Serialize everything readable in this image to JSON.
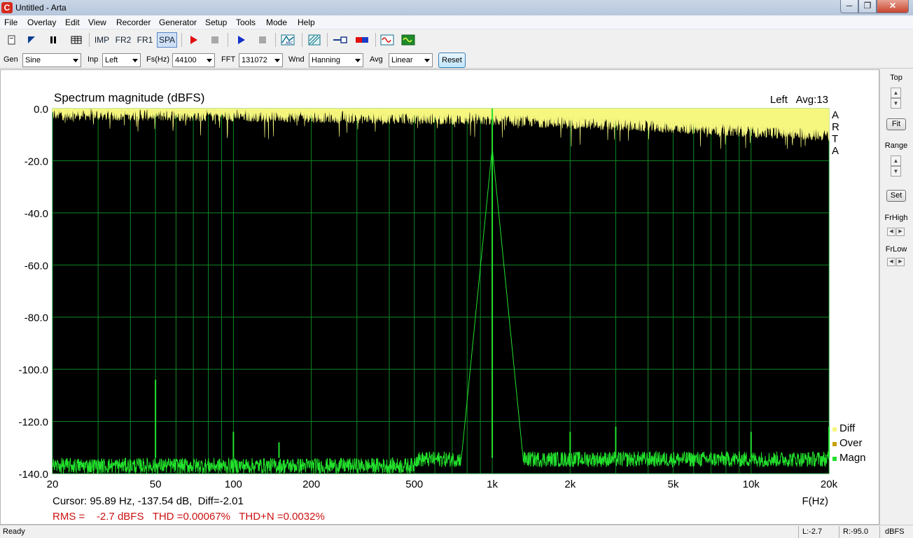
{
  "window": {
    "title": "Untitled - Arta",
    "app_icon_letter": "C",
    "controls": [
      "minimize-icon",
      "restore-icon",
      "close-icon"
    ]
  },
  "menu": [
    "File",
    "Overlay",
    "Edit",
    "View",
    "Recorder",
    "Generator",
    "Setup",
    "Tools",
    "Mode",
    "Help"
  ],
  "toolbar": {
    "mode_buttons": [
      "IMP",
      "FR2",
      "FR1",
      "SPA"
    ],
    "active_mode": "SPA",
    "icons": [
      "new-file-icon",
      "open-marker-icon",
      "pause-icon",
      "grid-view-icon",
      "record-icon",
      "stop-icon",
      "play-icon",
      "stop-icon",
      "abc-icon",
      "hatch-icon",
      "probe-icon",
      "meter-icon",
      "generator-wave-icon",
      "scope-icon"
    ]
  },
  "controls": {
    "gen_label": "Gen",
    "gen_value": "Sine",
    "inp_label": "Inp",
    "inp_value": "Left",
    "fs_label": "Fs(Hz)",
    "fs_value": "44100",
    "fft_label": "FFT",
    "fft_value": "131072",
    "wnd_label": "Wnd",
    "wnd_value": "Hanning",
    "avg_label": "Avg",
    "avg_value": "Linear",
    "reset_label": "Reset"
  },
  "plot": {
    "title": "Spectrum magnitude (dBFS)",
    "channel_info": "Left   Avg:13",
    "logo_letters": [
      "A",
      "R",
      "T",
      "A"
    ],
    "y_ticks": [
      "0.0",
      "-20.0",
      "-40.0",
      "-60.0",
      "-80.0",
      "-100.0",
      "-120.0",
      "-140.0"
    ],
    "x_ticks": [
      "20",
      "50",
      "100",
      "200",
      "500",
      "1k",
      "2k",
      "5k",
      "10k",
      "20k"
    ],
    "x_unit": "F(Hz)",
    "legend": [
      {
        "name": "Diff",
        "color": "#f6f77f"
      },
      {
        "name": "Over",
        "color": "#c8a000"
      },
      {
        "name": "Magn",
        "color": "#22e22c"
      }
    ],
    "cursor_text": "Cursor: 95.89 Hz, -137.54 dB,  Diff=-2.01",
    "measure_text": "RMS =    -2.7 dBFS   THD =0.00067%   THD+N =0.0032%",
    "colors": {
      "background": "#000000",
      "grid": "#0e8a23",
      "magn": "#22e22c",
      "diff": "#f6f77f",
      "over": "#c8a000",
      "measure_text": "#cc1111"
    }
  },
  "chart_data": {
    "type": "line",
    "title": "Spectrum magnitude (dBFS)",
    "xlabel": "F(Hz)",
    "ylabel": "",
    "x_scale": "log",
    "xlim": [
      20,
      20000
    ],
    "ylim": [
      -140,
      0
    ],
    "grid": true,
    "legend_position": "bottom-right",
    "series": [
      {
        "name": "Magn",
        "noise_floor_db": -137,
        "peaks": [
          [
            50,
            -104
          ],
          [
            100,
            -124
          ],
          [
            150,
            -128
          ],
          [
            1000,
            0
          ],
          [
            2000,
            -124
          ],
          [
            3000,
            -122
          ],
          [
            10000,
            -124
          ],
          [
            20000,
            -122
          ]
        ]
      },
      {
        "name": "Diff",
        "envelope": [
          [
            20,
            -1
          ],
          [
            100,
            -1.5
          ],
          [
            1000,
            -3
          ],
          [
            5000,
            -6
          ],
          [
            20000,
            -9
          ]
        ]
      },
      {
        "name": "Over"
      }
    ]
  },
  "sidepanel": {
    "top_label": "Top",
    "fit_label": "Fit",
    "range_label": "Range",
    "set_label": "Set",
    "frhigh_label": "FrHigh",
    "frlow_label": "FrLow"
  },
  "status": {
    "ready": "Ready",
    "l_value": "L:-2.7",
    "r_value": "R:-95.0",
    "unit": "dBFS"
  }
}
